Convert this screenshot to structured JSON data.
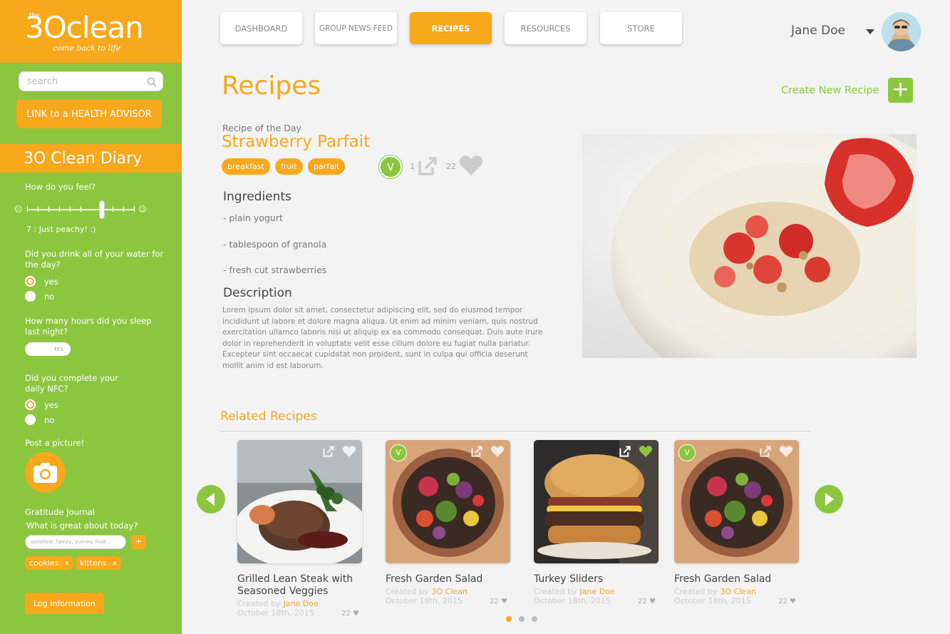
{
  "brand": {
    "the": "the",
    "name": "3Oclean",
    "tagline": "come back to life"
  },
  "search": {
    "placeholder": "search"
  },
  "sidebar": {
    "advisor_label": "LINK to a HEALTH ADVISOR",
    "diary_title": "3O Clean Diary",
    "feel_question": "How do you feel?",
    "feel_value": 7,
    "feel_max": 10,
    "feel_text": "7 : Just peachy!  :)",
    "water_question": "Did you drink all of your water for the day?",
    "water_options": [
      "yes",
      "no"
    ],
    "water_selected": "yes",
    "sleep_question": "How many hours did you sleep last night?",
    "sleep_unit": "hrs",
    "nfc_question": "Did you complete your daily NFC?",
    "nfc_options": [
      "yes",
      "no"
    ],
    "nfc_selected": "yes",
    "picture_label": "Post a picture!",
    "gratitude_title": "Gratitude Journal",
    "gratitude_question": "What is great about today?",
    "gratitude_placeholder": "sunshine, family, yummy food...",
    "gratitude_add": "+",
    "chips": [
      "cookies",
      "kittens"
    ],
    "chip_remove": "x",
    "log_label": "Log Information"
  },
  "nav": {
    "items": [
      "DASHBOARD",
      "GROUP NEWS FEED",
      "RECIPES",
      "RESOURCES",
      "STORE"
    ],
    "active": "RECIPES"
  },
  "user": {
    "name": "Jane Doe"
  },
  "page": {
    "title": "Recipes",
    "create_label": "Create New Recipe",
    "create_icon": "+"
  },
  "recipe_of_day": {
    "label": "Recipe of the Day",
    "title": "Strawberry Parfait",
    "tags": [
      "breakfast",
      "fruit",
      "parfait"
    ],
    "veg_badge": "V",
    "shares": "1",
    "likes": "22",
    "ingredients_heading": "Ingredients",
    "ingredients": [
      "- plain yogurt",
      "- tablespoon of granola",
      "- fresh cut strawberries"
    ],
    "description_heading": "Description",
    "description": "Lorem ipsum dolor sit amet, consectetur adipiscing elit, sed do eiusmod tempor incididunt ut labore et dolore magna aliqua. Ut enim ad minim veniam, quis nostrud exercitation ullamco laboris nisi ut aliquip ex ea commodo consequat. Duis aute irure dolor in reprehenderit in voluptate velit esse cillum dolore eu fugiat nulla pariatur. Excepteur sint occaecat cupidatat non proident, sunt in culpa qui officia deserunt mollit anim id est laborum."
  },
  "related": {
    "heading": "Related Recipes",
    "created_by_label": "Created by",
    "cards": [
      {
        "title": "Grilled Lean Steak with Seasoned Veggies",
        "author": "Jane Doe",
        "date": "October 18th, 2015",
        "likes": "22",
        "veg": false,
        "liked": false
      },
      {
        "title": "Fresh Garden Salad",
        "author": "3O Clean",
        "date": "October 18th, 2015",
        "likes": "22",
        "veg": true,
        "liked": false
      },
      {
        "title": "Turkey Sliders",
        "author": "Jane Doe",
        "date": "October 18th, 2015",
        "likes": "22",
        "veg": false,
        "liked": true
      },
      {
        "title": "Fresh Garden Salad",
        "author": "3O Clean",
        "date": "October 18th, 2015",
        "likes": "22",
        "veg": true,
        "liked": false
      }
    ],
    "pages": 3,
    "active_page": 1
  },
  "colors": {
    "orange": "#f7a81b",
    "green": "#8cc63f",
    "background": "#f3f3f3"
  }
}
